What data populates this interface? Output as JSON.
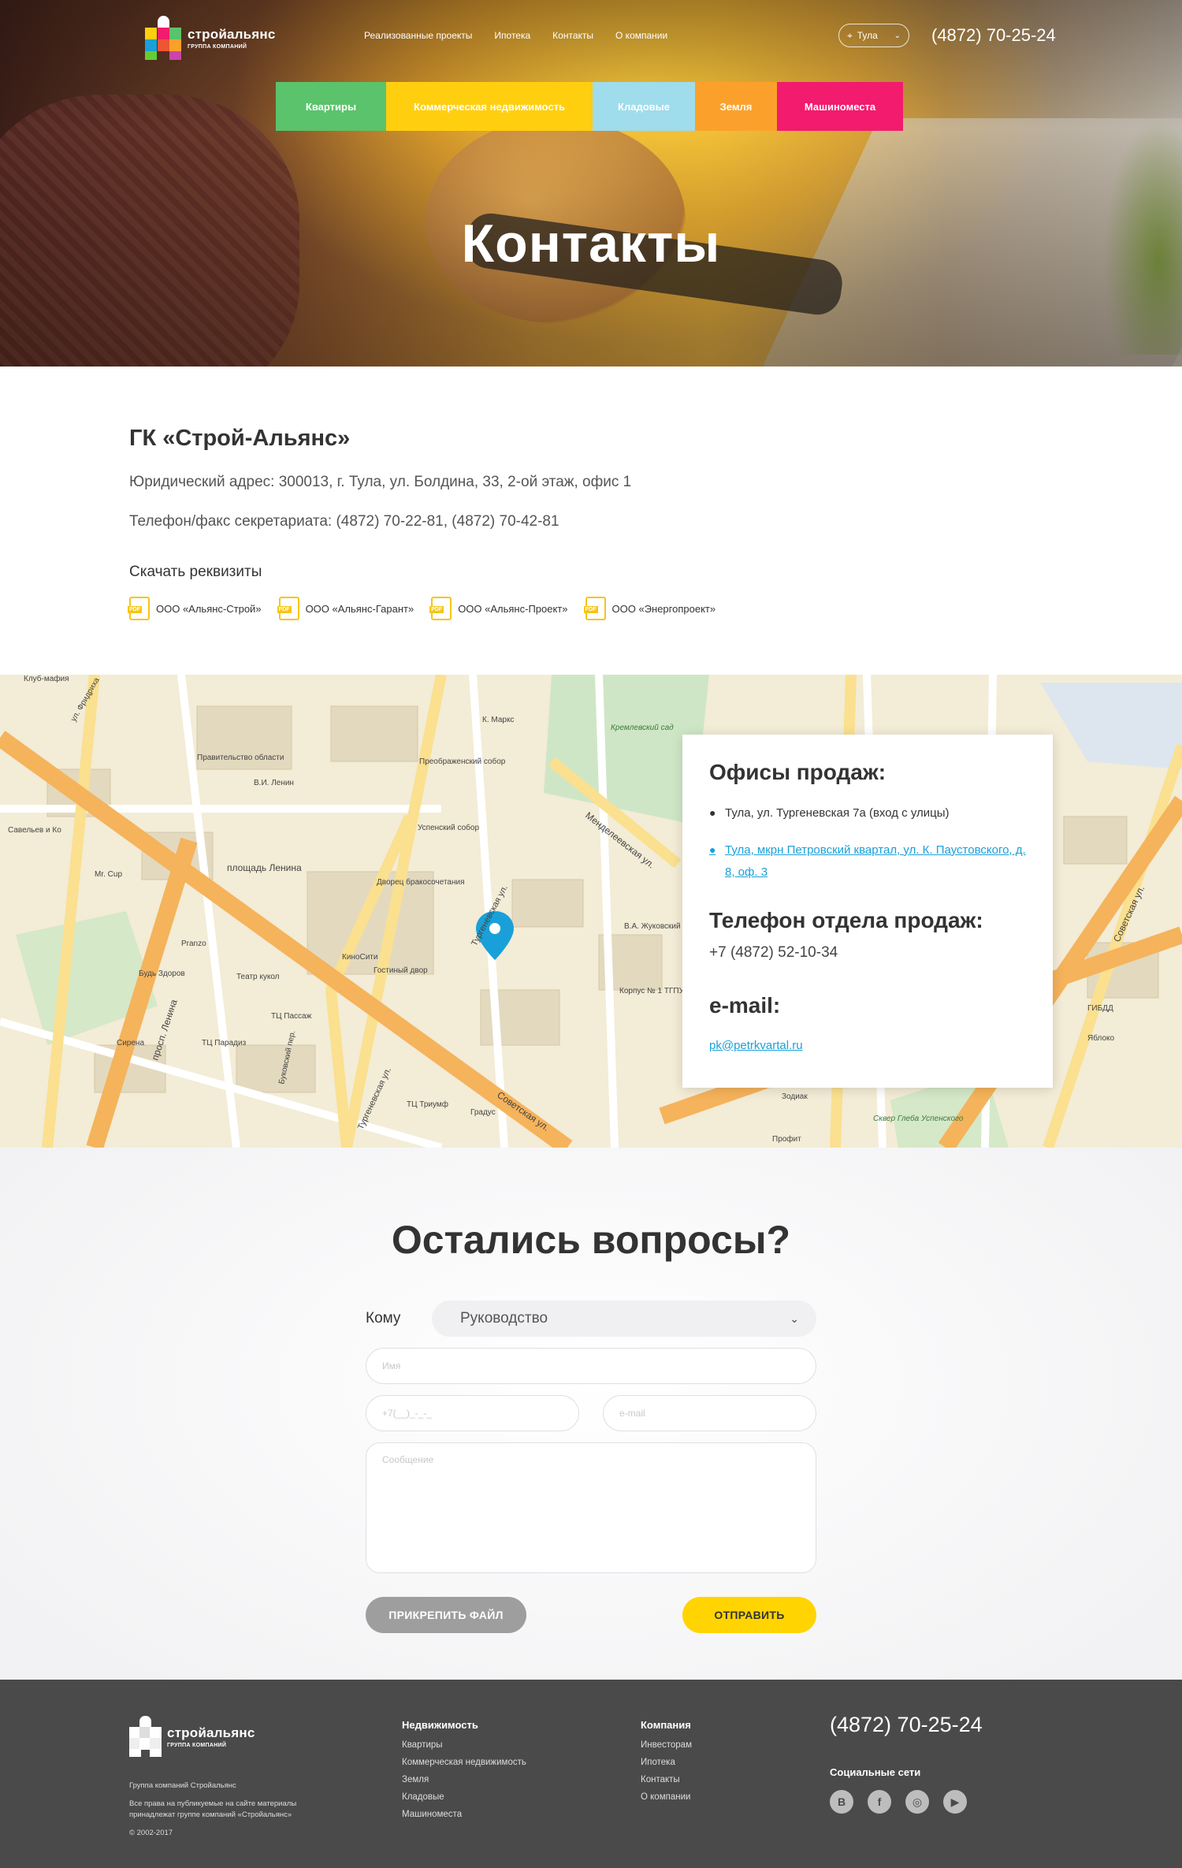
{
  "brand": {
    "name": "стройальянс",
    "sub": "ГРУППА КОМПАНИЙ"
  },
  "topnav": [
    "Реализованные проекты",
    "Ипотека",
    "Контакты",
    "О компании"
  ],
  "city": "Тула",
  "phone": "(4872) 70-25-24",
  "categories": [
    {
      "label": "Квартиры",
      "color": "#5bc36b"
    },
    {
      "label": "Коммерческая недвижимость",
      "color": "#ffcf0f"
    },
    {
      "label": "Кладовые",
      "color": "#9fdcec"
    },
    {
      "label": "Земля",
      "color": "#fba12b"
    },
    {
      "label": "Машиноместа",
      "color": "#f21b6d"
    }
  ],
  "hero_title": "Контакты",
  "company": {
    "title": "ГК «Строй-Альянс»",
    "address": "Юридический адрес: 300013, г. Тула, ул. Болдина, 33, 2-ой этаж, офис 1",
    "fax": "Телефон/факс секретариата: (4872) 70-22-81, (4872) 70-42-81",
    "download_title": "Скачать реквизиты",
    "pdf_label": "PDF",
    "docs": [
      "ООО «Альянс-Строй»",
      "ООО «Альянс-Гарант»",
      "ООО «Альянс-Проект»",
      "ООО «Энергопроект»"
    ]
  },
  "offices": {
    "title": "Офисы продаж:",
    "items": [
      "Тула, ул. Тургеневская 7а (вход с улицы)",
      "Тула, мкрн Петровский квартал, ул. К. Паустовского, д. 8, оф. 3"
    ],
    "phone_title": "Телефон отдела продаж:",
    "phone": "+7 (4872) 52-10-34",
    "email_title": "e-mail:",
    "email": "pk@petrkvartal.ru"
  },
  "map_labels": [
    "Клуб-мафия",
    "ул. Фридриха",
    "К. Маркс",
    "Кремлевский сад",
    "Правительство области",
    "В.И. Ленин",
    "Преображенский собор",
    "Успенский собор",
    "площадь Ленина",
    "Дворец бракосочетания",
    "Менделеевская ул.",
    "Тургеневская ул.",
    "В.А. Жуковский",
    "КиноСити",
    "Гостиный двор",
    "Корпус № 1 ТГПУ",
    "Театр кукол",
    "ТЦ Пассаж",
    "Будь Здоров",
    "Pranzo",
    "Mr. Cup",
    "Савельев и Ко",
    "просп. Ленина",
    "Сирена",
    "ТЦ Парадиз",
    "Буковский пер.",
    "Тургеневская ул.",
    "ТЦ Триумф",
    "Советская ул.",
    "Градус",
    "Зодиак",
    "Сквер Глеба Успенского",
    "Профит",
    "Советская ул.",
    "ГИБДД",
    "Яблоко"
  ],
  "form": {
    "title": "Остались вопросы?",
    "to_label": "Кому",
    "to_value": "Руководство",
    "name_ph": "Имя",
    "phone_ph": "+7(__)_-_-_",
    "email_ph": "e-mail",
    "message_ph": "Сообщение",
    "attach": "ПРИКРЕПИТЬ ФАЙЛ",
    "send": "ОТПРАВИТЬ"
  },
  "footer": {
    "info1": "Группа компаний Стройальянс",
    "info2": "Все права на публикуемые на сайте материалы принадлежат группе компаний «Стройальянс»",
    "copyright": "© 2002-2017",
    "col1_title": "Недвижимость",
    "col1": [
      "Квартиры",
      "Коммерческая недвижимость",
      "Земля",
      "Кладовые",
      "Машиноместа"
    ],
    "col2_title": "Компания",
    "col2": [
      "Инвесторам",
      "Ипотека",
      "Контакты",
      "О компании"
    ],
    "phone": "(4872) 70-25-24",
    "social_title": "Социальные сети",
    "socials": [
      "B",
      "f",
      "◎",
      "▶"
    ]
  }
}
